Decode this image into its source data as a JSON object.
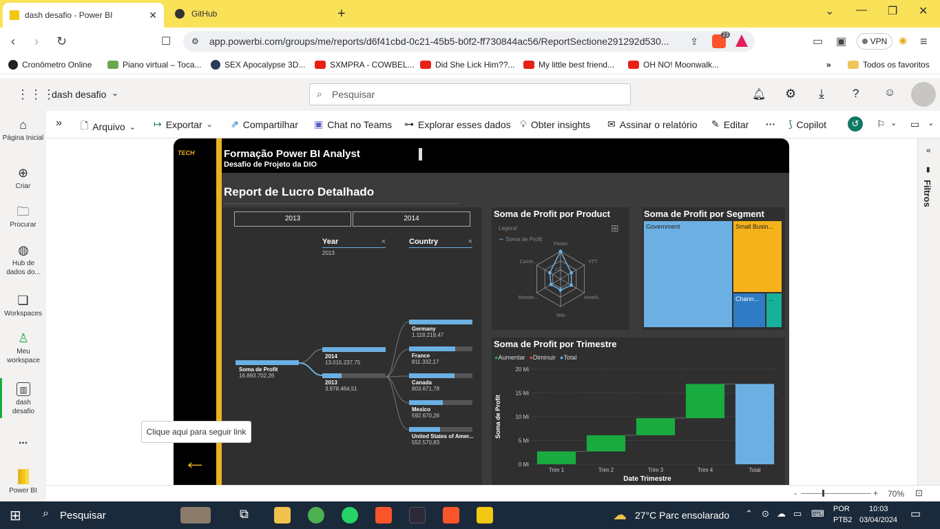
{
  "browser": {
    "tabs": [
      {
        "title": "dash desafio - Power BI",
        "active": true
      },
      {
        "title": "GitHub",
        "active": false
      }
    ],
    "url": "app.powerbi.com/groups/me/reports/d6f41cbd-0c21-45b5-b0f2-ff730844ac56/ReportSectione291292d530...",
    "shield_count": "23",
    "vpn_label": "VPN",
    "bookmarks": [
      {
        "label": "Cronômetro Online",
        "color": "#222222"
      },
      {
        "label": "Piano virtual – Toca...",
        "color": "#6aa84f"
      },
      {
        "label": "SEX Apocalypse 3D...",
        "color": "#2b3b5e"
      },
      {
        "label": "SXMPRA - COWBEL...",
        "color": "#e62117"
      },
      {
        "label": "Did She Lick Him??...",
        "color": "#e62117"
      },
      {
        "label": "My little best friend...",
        "color": "#e62117"
      },
      {
        "label": "OH NO! Moonwalk...",
        "color": "#e62117"
      }
    ],
    "all_favorites": "Todos os favoritos"
  },
  "pbi": {
    "workspace_title": "dash desafio",
    "search_placeholder": "Pesquisar",
    "rail": [
      {
        "label": "Página Inicial",
        "icon": "home-icon"
      },
      {
        "label": "Criar",
        "icon": "plus-circle-icon"
      },
      {
        "label": "Procurar",
        "icon": "folder-icon"
      },
      {
        "label": "Hub de dados do...",
        "icon": "data-hub-icon"
      },
      {
        "label": "Workspaces",
        "icon": "workspaces-icon"
      },
      {
        "label": "Meu workspace",
        "icon": "person-icon"
      },
      {
        "label": "dash desafio",
        "icon": "report-icon"
      },
      {
        "label": "...",
        "icon": "more-icon"
      },
      {
        "label": "Power BI",
        "icon": "powerbi-logo-icon"
      }
    ],
    "toolbar": {
      "arquivo": "Arquivo",
      "exportar": "Exportar",
      "compartilhar": "Compartilhar",
      "chat_teams": "Chat no Teams",
      "explorar": "Explorar esses dados",
      "insights": "Obter insights",
      "assinar": "Assinar o relatório",
      "editar": "Editar",
      "copilot": "Copilot"
    },
    "filters_label": "Filtros",
    "zoom": "70%",
    "tooltip": "Clique aqui para seguir link"
  },
  "report": {
    "logo_text": "TECH",
    "title": "Formação Power BI Analyst",
    "subtitle": "Desafio de Projeto da DIO",
    "page_heading": "Report de Lucro Detalhado",
    "year_buttons": [
      "2013",
      "2014"
    ],
    "decomp": {
      "col_year": "Year",
      "col_year_sel": "2013",
      "col_country": "Country",
      "root_label": "Soma de Profit",
      "root_value": "16.893.702,26",
      "years": [
        {
          "label": "2014",
          "value": "13.015.237,75",
          "frac": 1.0
        },
        {
          "label": "2013",
          "value": "3.878.464,51",
          "frac": 0.3
        }
      ],
      "countries": [
        {
          "label": "Germany",
          "value": "1.118.219,47",
          "frac": 1.0
        },
        {
          "label": "France",
          "value": "811.332,17",
          "frac": 0.73
        },
        {
          "label": "Canada",
          "value": "803.671,78",
          "frac": 0.72
        },
        {
          "label": "Mexico",
          "value": "592.670,26",
          "frac": 0.53
        },
        {
          "label": "United States of Amer...",
          "value": "552.570,83",
          "frac": 0.49
        }
      ]
    },
    "radar": {
      "title": "Soma de Profit por Product",
      "legend_title": "Legend",
      "legend_item": "Soma de Profit",
      "axes": [
        "Paseo",
        "VTT",
        "Amaril...",
        "Velo",
        "Montan...",
        "Carret..."
      ],
      "values": [
        1.0,
        0.45,
        0.45,
        0.4,
        0.4,
        0.45
      ],
      "ring_label": "2,5..."
    },
    "treemap": {
      "title": "Soma de Profit por Segment",
      "items": [
        {
          "label": "Government",
          "color": "#6cb0e3"
        },
        {
          "label": "Small Busin...",
          "color": "#f5b21b"
        },
        {
          "label": "Chann...",
          "color": "#2f7bc4"
        },
        {
          "label": "...",
          "color": "#17b09b"
        }
      ]
    },
    "waterfall": {
      "title": "Soma de Profit por Trimestre",
      "legend": [
        {
          "label": "Aumentar",
          "color": "#1aab40"
        },
        {
          "label": "Diminuir",
          "color": "#e8414b"
        },
        {
          "label": "Total",
          "color": "#6cb0e3"
        }
      ],
      "ylabel": "Soma de Profit",
      "xlabel": "Date Trimestre",
      "yticks": [
        "0 Mi",
        "5 Mi",
        "10 Mi",
        "15 Mi",
        "20 Mi"
      ]
    }
  },
  "chart_data": {
    "type": "bar",
    "title": "Soma de Profit por Trimestre",
    "xlabel": "Date Trimestre",
    "ylabel": "Soma de Profit",
    "categories": [
      "Trim 1",
      "Trim 2",
      "Trim 3",
      "Trim 4",
      "Total"
    ],
    "series": [
      {
        "name": "Aumentar",
        "values": [
          2.7,
          3.4,
          3.6,
          7.2,
          null
        ]
      },
      {
        "name": "Total",
        "values": [
          null,
          null,
          null,
          null,
          16.9
        ]
      }
    ],
    "waterfall_starts": [
      0,
      2.7,
      6.1,
      9.7,
      0
    ],
    "ylim": [
      0,
      20
    ],
    "grid": true,
    "legend": "top-left"
  },
  "taskbar": {
    "search": "Pesquisar",
    "weather": "27°C  Parc ensolarado",
    "lang": "POR",
    "lang2": "PTB2",
    "time": "10:03",
    "date": "03/04/2024"
  }
}
